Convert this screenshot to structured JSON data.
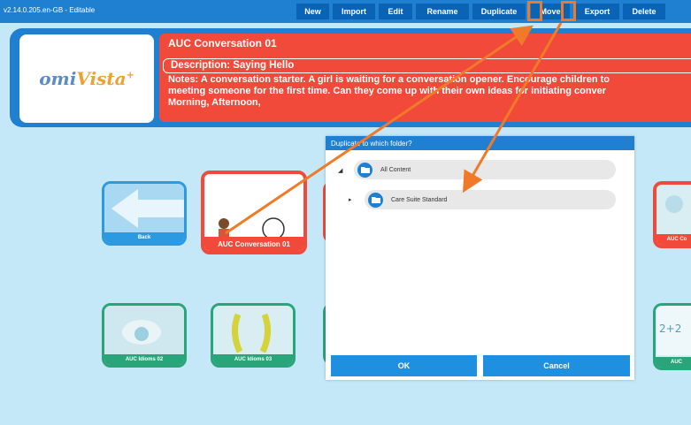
{
  "app": {
    "version": "v2.14.0.205.en-GB - Editable"
  },
  "toolbar": {
    "new": "New",
    "import": "Import",
    "edit": "Edit",
    "rename": "Rename",
    "duplicate": "Duplicate",
    "move": "Move",
    "export": "Export",
    "delete": "Delete"
  },
  "logo": {
    "prefix": "omi",
    "suffix": "Vista",
    "plus": "+"
  },
  "content": {
    "title": "AUC Conversation 01",
    "description": "Description: Saying Hello",
    "notes_line1": "Notes: A conversation starter. A girl is waiting for a conversation opener. Encourage children to",
    "notes_line2": "meeting someone for the first time.  Can they come up with their own ideas for initiating conver",
    "notes_line3": "Morning, Afternoon,"
  },
  "tiles": {
    "back": "Back",
    "selected": "AUC Conversation 01",
    "right_top": "AUC Co",
    "idioms02": "AUC Idioms 02",
    "idioms03": "AUC Idioms 03",
    "right_bottom": "AUC"
  },
  "dialog": {
    "title": "Duplicate to which folder?",
    "folders": [
      "All Content",
      "Care Suite Standard"
    ],
    "ok": "OK",
    "cancel": "Cancel"
  },
  "colors": {
    "topbar": "#1f7fd0",
    "accent_red": "#f24a3a",
    "highlight": "#f07a28",
    "bg": "#c4e8f8"
  }
}
